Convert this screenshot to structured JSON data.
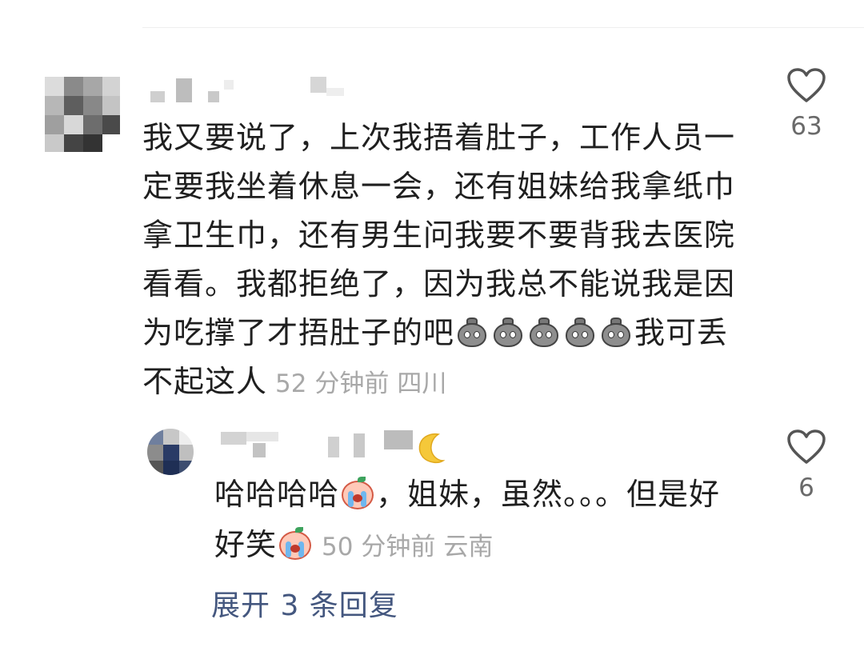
{
  "comment": {
    "text_before_emoji": "我又要说了，上次我捂着肚子，工作人员一定要我坐着休息一会，还有姐妹给我拿纸巾拿卫生巾，还有男生问我要不要背我去医院看看。我都拒绝了，因为我总不能说我是因为吃撑了才捂肚子的吧",
    "emoji_name": "money-bag-emoji",
    "emoji_count": 5,
    "text_after_emoji": "我可丢不起这人",
    "time": "52 分钟前",
    "location": "四川",
    "like_count": "63",
    "like_icon": "heart-outline-icon"
  },
  "reply": {
    "text_part1": "哈哈哈哈",
    "text_part2": "，姐妹，虽然。。。但是好好笑",
    "emoji_name": "crying-laughing-emoji",
    "username_emoji": "crescent-moon-emoji",
    "time": "50 分钟前",
    "location": "云南",
    "like_count": "6",
    "like_icon": "heart-outline-icon"
  },
  "expand_replies": {
    "label": "展开 3 条回复"
  },
  "colors": {
    "text": "#1f1f1f",
    "meta": "#a8a8a8",
    "link": "#44577f",
    "like_count": "#6a6a6a"
  }
}
